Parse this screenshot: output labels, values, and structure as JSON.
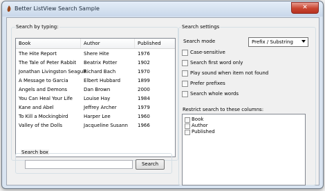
{
  "window": {
    "title": "Better ListView Search Sample",
    "close_glyph": "✕"
  },
  "left": {
    "group_label": "Search by typing:",
    "columns": [
      "Book",
      "Author",
      "Published"
    ],
    "rows": [
      [
        "The Hite Report",
        "Shere Hite",
        "1976"
      ],
      [
        "The Tale of Peter Rabbit",
        "Beatrix Potter",
        "1902"
      ],
      [
        "Jonathan Livingston Seagull",
        "Richard Bach",
        "1970"
      ],
      [
        "A Message to Garcia",
        "Elbert Hubbard",
        "1899"
      ],
      [
        "Angels and Demons",
        "Dan Brown",
        "2000"
      ],
      [
        "You Can Heal Your Life",
        "Louise Hay",
        "1984"
      ],
      [
        "Kane and Abel",
        "Jeffrey Archer",
        "1979"
      ],
      [
        "To Kill a Mockingbird",
        "Harper Lee",
        "1960"
      ],
      [
        "Valley of the Dolls",
        "Jacqueline Susann",
        "1966"
      ]
    ],
    "search_box": {
      "label": "Search box",
      "value": "",
      "button": "Search"
    }
  },
  "right": {
    "group_label": "Search settings",
    "mode_label": "Search mode",
    "mode_value": "Prefix / Substring",
    "options": [
      {
        "label": "Case-sensitive",
        "checked": false
      },
      {
        "label": "Search first word only",
        "checked": false
      },
      {
        "label": "Play sound when item not found",
        "checked": false
      },
      {
        "label": "Prefer prefixes",
        "checked": false
      },
      {
        "label": "Search whole words",
        "checked": false
      }
    ],
    "restrict_label": "Restrict search to these columns:",
    "restrict_columns": [
      {
        "label": "Book",
        "checked": false
      },
      {
        "label": "Author",
        "checked": false
      },
      {
        "label": "Published",
        "checked": false
      }
    ]
  }
}
